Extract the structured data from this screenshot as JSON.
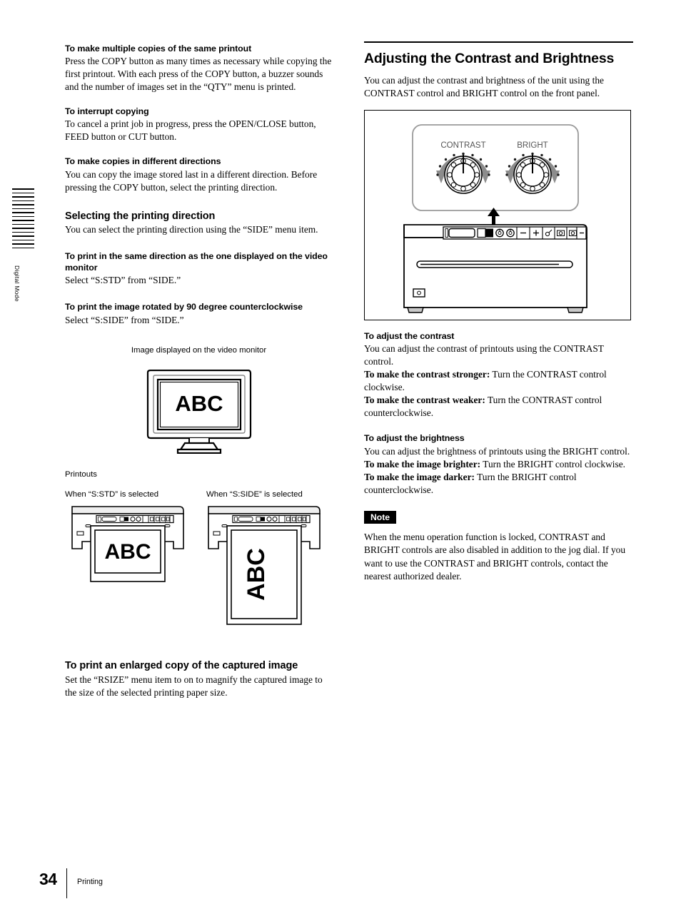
{
  "edge_tab": {
    "label": "Digital Mode"
  },
  "left_column": {
    "blocks": [
      {
        "heading": "To make multiple copies of the same printout",
        "body": "Press the COPY button as many times as necessary while copying the first printout. With each press of the COPY button, a buzzer sounds and the number of images set in the “QTY” menu is printed."
      },
      {
        "heading": "To interrupt copying",
        "body": "To cancel a print job in progress, press the OPEN/CLOSE button, FEED button or CUT button."
      },
      {
        "heading": "To make copies in different directions",
        "body": "You can copy the image stored last in a different direction. Before pressing the COPY button, select the printing direction."
      }
    ],
    "section": {
      "heading": "Selecting the printing direction",
      "body": "You can select the printing direction using the “SIDE” menu item."
    },
    "direction_blocks": [
      {
        "heading": "To print in the same direction as the one displayed on the video monitor",
        "body": "Select “S:STD” from “SIDE.”"
      },
      {
        "heading": "To print the image rotated by 90 degree counterclockwise",
        "body": "Select “S:SIDE” from “SIDE.”"
      }
    ],
    "figure": {
      "monitor_caption": "Image displayed on the video monitor",
      "screen_text": "ABC",
      "printouts_caption": "Printouts",
      "printout_left_caption": "When “S:STD” is selected",
      "printout_right_caption": "When “S:SIDE” is selected",
      "printout_left_text": "ABC",
      "printout_right_text": "ABC"
    },
    "enlarged": {
      "heading": "To print an enlarged copy of the captured image",
      "body": "Set the “RSIZE” menu item to on to magnify the captured image to the size of the selected printing paper size."
    }
  },
  "right_column": {
    "title": "Adjusting the Contrast and Brightness",
    "intro": "You can adjust the contrast and brightness of the unit using the CONTRAST control and BRIGHT control on the front panel.",
    "figure": {
      "knob_left_label": "CONTRAST",
      "knob_right_label": "BRIGHT"
    },
    "contrast": {
      "heading": "To adjust the contrast",
      "body": "You can adjust the contrast of printouts using the CONTRAST control.",
      "stronger_lead": "To make the contrast stronger:",
      "stronger_rest": " Turn the CONTRAST control clockwise.",
      "weaker_lead": "To make the contrast weaker:",
      "weaker_rest": " Turn the CONTRAST control counterclockwise."
    },
    "brightness": {
      "heading": "To adjust the brightness",
      "body": "You can adjust the brightness of printouts using the BRIGHT control.",
      "brighter_lead": "To make the image brighter:",
      "brighter_rest": " Turn the BRIGHT control clockwise.",
      "darker_lead": "To make the image darker:",
      "darker_rest": " Turn the BRIGHT control counterclockwise."
    },
    "note": {
      "badge": "Note",
      "body": "When the menu operation function is locked, CONTRAST and BRIGHT controls are also disabled in addition to the jog dial. If you want to use the CONTRAST and BRIGHT controls, contact the nearest authorized dealer."
    }
  },
  "footer": {
    "page_number": "34",
    "section_label": "Printing"
  }
}
